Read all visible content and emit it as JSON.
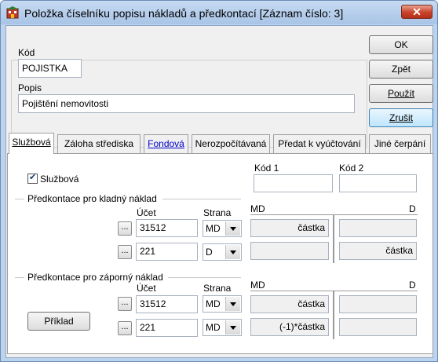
{
  "window": {
    "title": "Položka číselníku popisu nákladů a předkontací  [Záznam číslo: 3]",
    "close_label": "✕"
  },
  "record": {
    "kod_label": "Kód",
    "kod_value": "POJISTKA",
    "popis_label": "Popis",
    "popis_value": "Pojištění nemovitosti"
  },
  "buttons": {
    "ok": "OK",
    "zpet": "Zpět",
    "pouzit": "Použít",
    "zrusit": "Zrušit",
    "priklad": "Příklad"
  },
  "tabs": [
    {
      "label": "Službová",
      "active": true
    },
    {
      "label": "Záloha střediska"
    },
    {
      "label": "Fondová"
    },
    {
      "label": "Nerozpočítávaná"
    },
    {
      "label": "Předat k vyúčtování"
    },
    {
      "label": "Jiné čerpání"
    }
  ],
  "sluzbova": {
    "checkbox_label": "Službová",
    "checked": true,
    "kod1_label": "Kód 1",
    "kod1_value": "",
    "kod2_label": "Kód 2",
    "kod2_value": ""
  },
  "kladny": {
    "section_label": "Předkontace pro kladný náklad",
    "ucet_label": "Účet",
    "strana_label": "Strana",
    "md_label": "MD",
    "d_label": "D",
    "rows": [
      {
        "dots": "...",
        "ucet": "31512",
        "strana": "MD",
        "md": "částka",
        "d": ""
      },
      {
        "dots": "...",
        "ucet": "221",
        "strana": "D",
        "md": "",
        "d": "částka"
      }
    ]
  },
  "zaporny": {
    "section_label": "Předkontace pro záporný náklad",
    "ucet_label": "Účet",
    "strana_label": "Strana",
    "md_label": "MD",
    "d_label": "D",
    "rows": [
      {
        "dots": "...",
        "ucet": "31512",
        "strana": "MD",
        "md": "částka",
        "d": ""
      },
      {
        "dots": "...",
        "ucet": "221",
        "strana": "MD",
        "md": "(-1)*částka",
        "d": ""
      }
    ]
  }
}
